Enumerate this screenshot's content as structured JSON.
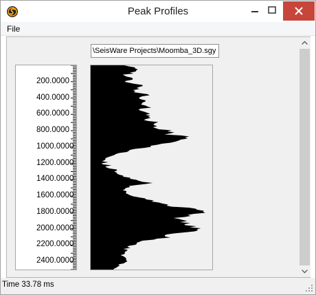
{
  "window": {
    "title": "Peak Profiles"
  },
  "menu": {
    "file_label": "File"
  },
  "file_path": "\\SeisWare Projects\\Moomba_3D.sgy",
  "axis": {
    "tick_labels": [
      "200.0000",
      "400.0000",
      "600.0000",
      "800.0000",
      "1000.0000",
      "1200.0000",
      "1400.0000",
      "1600.0000",
      "1800.0000",
      "2000.0000",
      "2200.0000",
      "2400.0000"
    ]
  },
  "status": {
    "text": "Time 33.78 ms"
  },
  "colors": {
    "close_button": "#c7463b",
    "profile_fill": "#000000"
  },
  "chart_data": {
    "type": "area",
    "y_range": [
      0,
      2500
    ],
    "y_ticks": [
      200,
      400,
      600,
      800,
      1000,
      1200,
      1400,
      1600,
      1800,
      2000,
      2200,
      2400
    ],
    "profile": [
      [
        0,
        0.3
      ],
      [
        40,
        0.38
      ],
      [
        80,
        0.35
      ],
      [
        120,
        0.25
      ],
      [
        160,
        0.35
      ],
      [
        200,
        0.28
      ],
      [
        240,
        0.42
      ],
      [
        280,
        0.38
      ],
      [
        320,
        0.34
      ],
      [
        360,
        0.5
      ],
      [
        400,
        0.38
      ],
      [
        440,
        0.46
      ],
      [
        480,
        0.42
      ],
      [
        520,
        0.44
      ],
      [
        560,
        0.4
      ],
      [
        600,
        0.47
      ],
      [
        640,
        0.5
      ],
      [
        680,
        0.44
      ],
      [
        720,
        0.56
      ],
      [
        760,
        0.53
      ],
      [
        800,
        0.66
      ],
      [
        840,
        0.63
      ],
      [
        880,
        0.79
      ],
      [
        920,
        0.74
      ],
      [
        960,
        0.6
      ],
      [
        1000,
        0.45
      ],
      [
        1040,
        0.33
      ],
      [
        1080,
        0.23
      ],
      [
        1120,
        0.15
      ],
      [
        1160,
        0.11
      ],
      [
        1200,
        0.08
      ],
      [
        1240,
        0.12
      ],
      [
        1280,
        0.2
      ],
      [
        1320,
        0.21
      ],
      [
        1360,
        0.27
      ],
      [
        1400,
        0.37
      ],
      [
        1440,
        0.5
      ],
      [
        1480,
        0.35
      ],
      [
        1520,
        0.26
      ],
      [
        1560,
        0.29
      ],
      [
        1600,
        0.33
      ],
      [
        1640,
        0.46
      ],
      [
        1680,
        0.53
      ],
      [
        1720,
        0.66
      ],
      [
        1760,
        0.86
      ],
      [
        1800,
        0.98
      ],
      [
        1840,
        0.79
      ],
      [
        1880,
        0.7
      ],
      [
        1920,
        0.77
      ],
      [
        1960,
        0.85
      ],
      [
        2000,
        0.88
      ],
      [
        2040,
        0.81
      ],
      [
        2080,
        0.6
      ],
      [
        2120,
        0.56
      ],
      [
        2160,
        0.4
      ],
      [
        2200,
        0.34
      ],
      [
        2240,
        0.3
      ],
      [
        2280,
        0.27
      ],
      [
        2320,
        0.29
      ],
      [
        2360,
        0.28
      ],
      [
        2400,
        0.29
      ],
      [
        2440,
        0.24
      ],
      [
        2480,
        0.21
      ],
      [
        2500,
        0.19
      ]
    ]
  }
}
